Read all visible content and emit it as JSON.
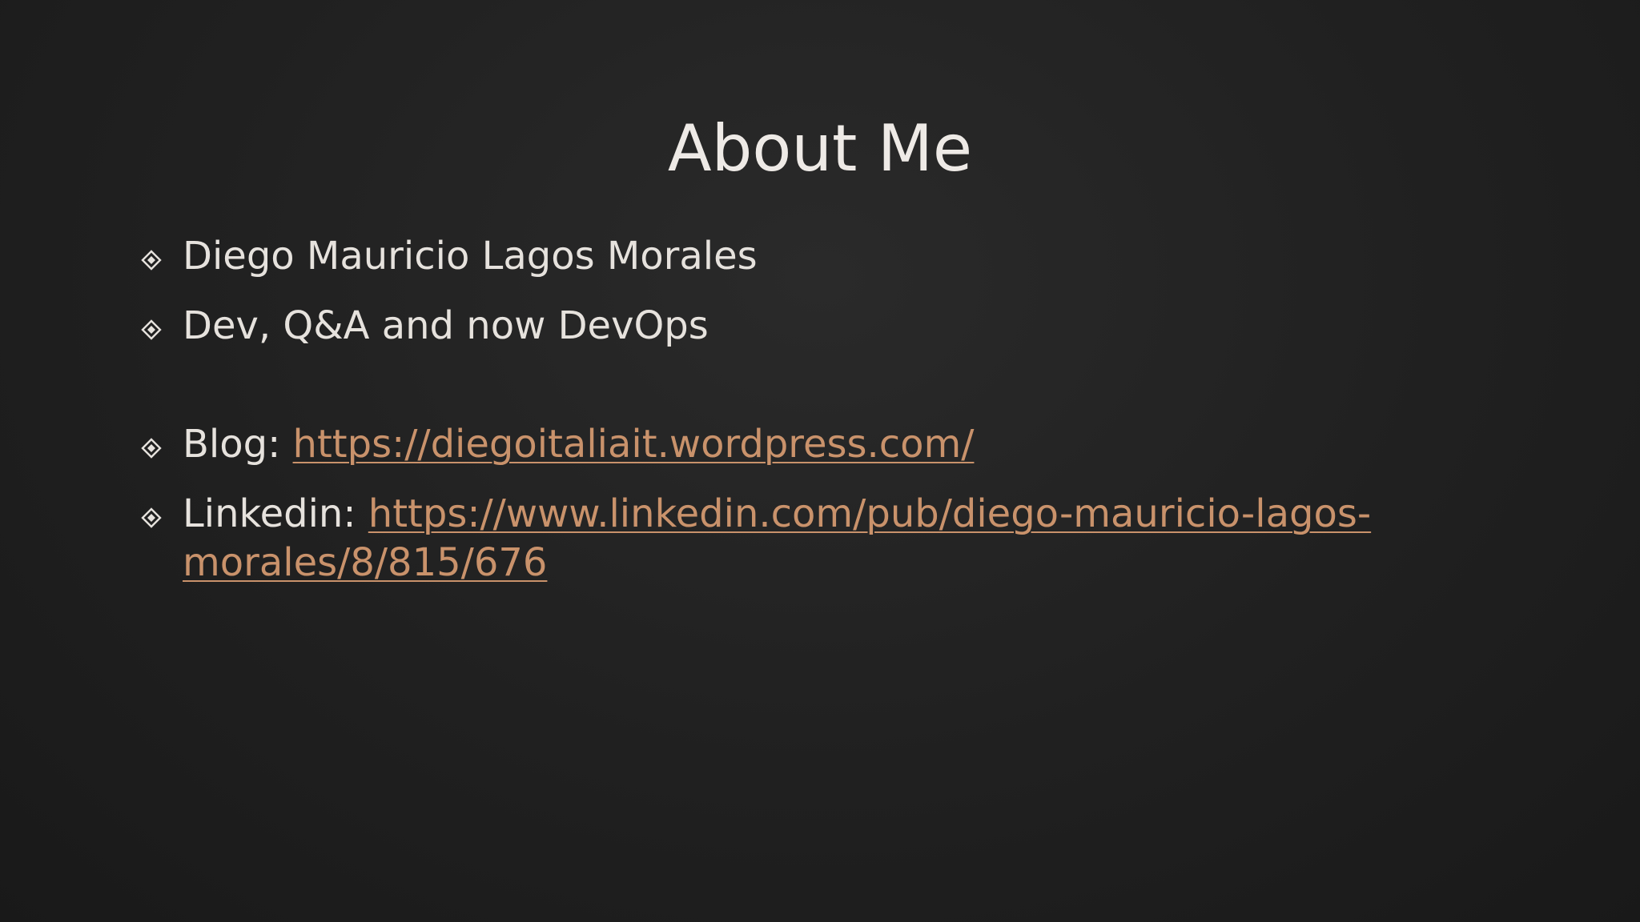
{
  "slide": {
    "title": "About Me",
    "bullets": [
      {
        "text": "Diego Mauricio Lagos Morales"
      },
      {
        "text": "Dev, Q&A and now DevOps"
      },
      {
        "label": "Blog: ",
        "link": "https://diegoitaliait.wordpress.com/"
      },
      {
        "label": "Linkedin: ",
        "link": "https://www.linkedin.com/pub/diego-mauricio-lagos-morales/8/815/676"
      }
    ],
    "colors": {
      "background": "#1f1f1f",
      "text": "#e6e2dd",
      "link": "#c9926b"
    },
    "bullet_icon": "diamond-bullet-icon"
  }
}
